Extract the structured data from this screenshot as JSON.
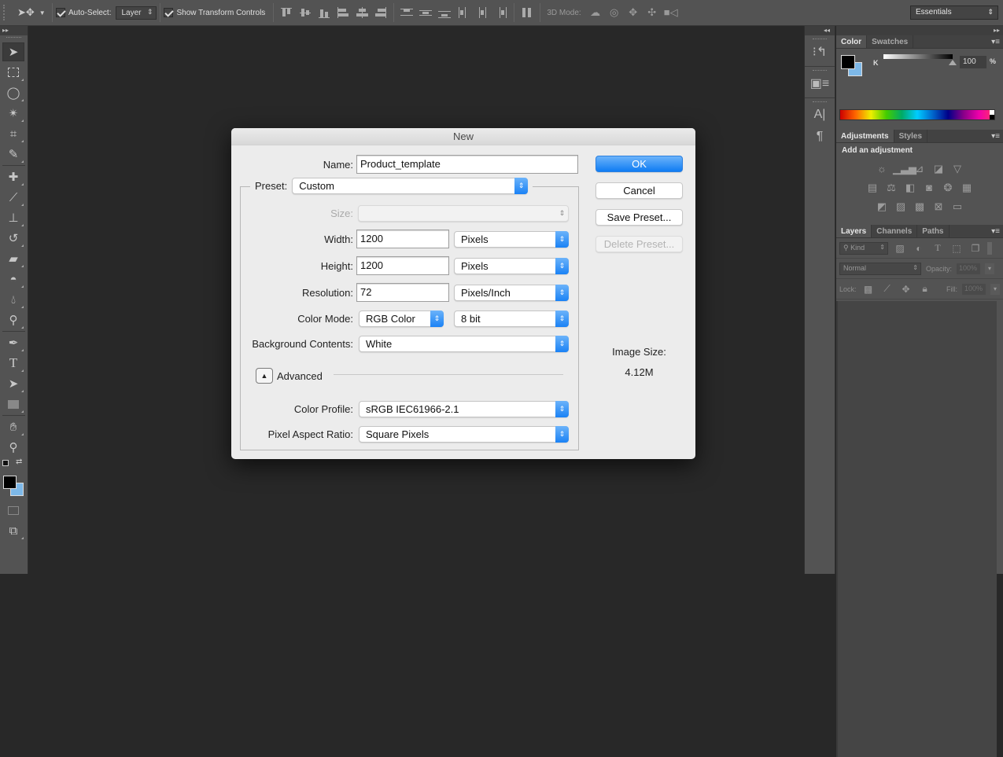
{
  "options_bar": {
    "auto_select_label": "Auto-Select:",
    "auto_select_checked": true,
    "auto_select_target": "Layer",
    "show_transform_label": "Show Transform Controls",
    "show_transform_checked": true,
    "mode_3d_label": "3D Mode:",
    "workspace": "Essentials"
  },
  "toolbar": {
    "tools": [
      "move",
      "rectangular-marquee",
      "lasso",
      "magic-wand",
      "crop",
      "eyedropper",
      "spot-healing-brush",
      "brush",
      "clone-stamp",
      "history-brush",
      "eraser",
      "paint-bucket",
      "blur",
      "dodge",
      "pen",
      "type",
      "path-selection",
      "rectangle",
      "hand",
      "zoom"
    ],
    "foreground_color": "#000000",
    "background_color": "#7db8e8"
  },
  "color_panel": {
    "tabs": [
      "Color",
      "Swatches"
    ],
    "active_tab": "Color",
    "channel_label": "K",
    "channel_value": "100",
    "channel_unit": "%"
  },
  "adjustments_panel": {
    "tabs": [
      "Adjustments",
      "Styles"
    ],
    "active_tab": "Adjustments",
    "title": "Add an adjustment"
  },
  "layers_panel": {
    "tabs": [
      "Layers",
      "Channels",
      "Paths"
    ],
    "active_tab": "Layers",
    "filter_kind": "Kind",
    "blend_mode": "Normal",
    "opacity_label": "Opacity:",
    "opacity_value": "100%",
    "lock_label": "Lock:",
    "fill_label": "Fill:",
    "fill_value": "100%"
  },
  "dialog": {
    "title": "New",
    "name_label": "Name:",
    "name_value": "Product_template",
    "preset_label": "Preset:",
    "preset_value": "Custom",
    "size_label": "Size:",
    "size_value": "",
    "width_label": "Width:",
    "width_value": "1200",
    "width_unit": "Pixels",
    "height_label": "Height:",
    "height_value": "1200",
    "height_unit": "Pixels",
    "resolution_label": "Resolution:",
    "resolution_value": "72",
    "resolution_unit": "Pixels/Inch",
    "color_mode_label": "Color Mode:",
    "color_mode_value": "RGB Color",
    "bit_depth_value": "8 bit",
    "background_label": "Background Contents:",
    "background_value": "White",
    "advanced_label": "Advanced",
    "color_profile_label": "Color Profile:",
    "color_profile_value": "sRGB IEC61966-2.1",
    "pixel_aspect_label": "Pixel Aspect Ratio:",
    "pixel_aspect_value": "Square Pixels",
    "ok_label": "OK",
    "cancel_label": "Cancel",
    "save_preset_label": "Save Preset...",
    "delete_preset_label": "Delete Preset...",
    "image_size_label": "Image Size:",
    "image_size_value": "4.12M"
  }
}
